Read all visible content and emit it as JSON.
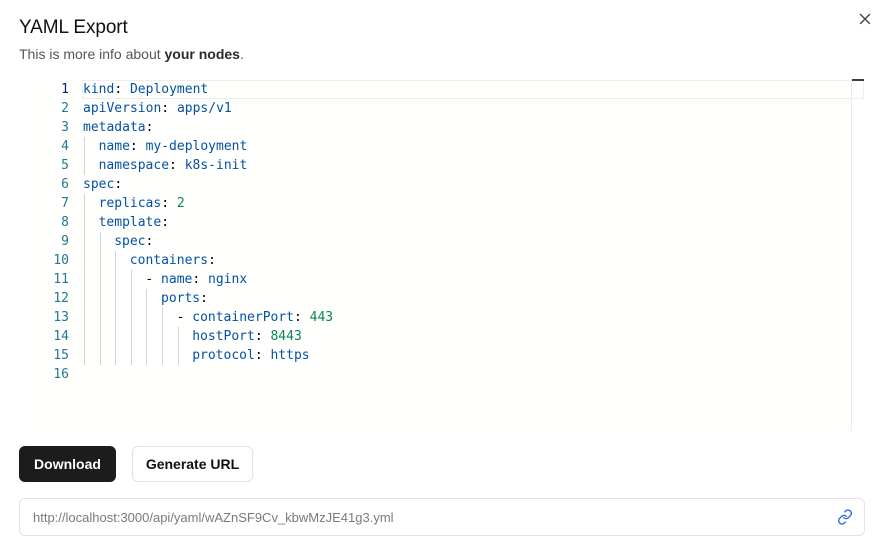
{
  "dialog": {
    "title": "YAML Export",
    "subtitle_prefix": "This is more info about ",
    "subtitle_bold": "your nodes",
    "subtitle_suffix": "."
  },
  "editor": {
    "active_line": 1,
    "line_numbers": [
      "1",
      "2",
      "3",
      "4",
      "5",
      "6",
      "7",
      "8",
      "9",
      "10",
      "11",
      "12",
      "13",
      "14",
      "15",
      "16"
    ],
    "lines": [
      {
        "indent": 0,
        "key": "kind",
        "value": "Deployment"
      },
      {
        "indent": 0,
        "key": "apiVersion",
        "value": "apps/v1"
      },
      {
        "indent": 0,
        "key": "metadata",
        "value": ""
      },
      {
        "indent": 1,
        "key": "name",
        "value": "my-deployment"
      },
      {
        "indent": 1,
        "key": "namespace",
        "value": "k8s-init"
      },
      {
        "indent": 0,
        "key": "spec",
        "value": ""
      },
      {
        "indent": 1,
        "key": "replicas",
        "value": "2",
        "numeric": true
      },
      {
        "indent": 1,
        "key": "template",
        "value": ""
      },
      {
        "indent": 2,
        "key": "spec",
        "value": ""
      },
      {
        "indent": 3,
        "key": "containers",
        "value": ""
      },
      {
        "indent": 4,
        "dash": true,
        "key": "name",
        "value": "nginx"
      },
      {
        "indent": 5,
        "key": "ports",
        "value": ""
      },
      {
        "indent": 6,
        "dash": true,
        "key": "containerPort",
        "value": "443",
        "numeric": true
      },
      {
        "indent": 7,
        "key": "hostPort",
        "value": "8443",
        "numeric": true
      },
      {
        "indent": 7,
        "key": "protocol",
        "value": "https"
      },
      {
        "indent": 0,
        "key": "",
        "value": ""
      }
    ]
  },
  "actions": {
    "download_label": "Download",
    "generate_label": "Generate URL"
  },
  "url": {
    "value": "http://localhost:3000/api/yaml/wAZnSF9Cv_kbwMzJE41g3.yml"
  },
  "icons": {
    "close": "close-icon",
    "link": "link-icon"
  },
  "colors": {
    "key": "#0451a5",
    "number": "#098658",
    "line_number": "#237893",
    "primary_button": "#1c1c1c",
    "link_icon": "#2563eb"
  }
}
